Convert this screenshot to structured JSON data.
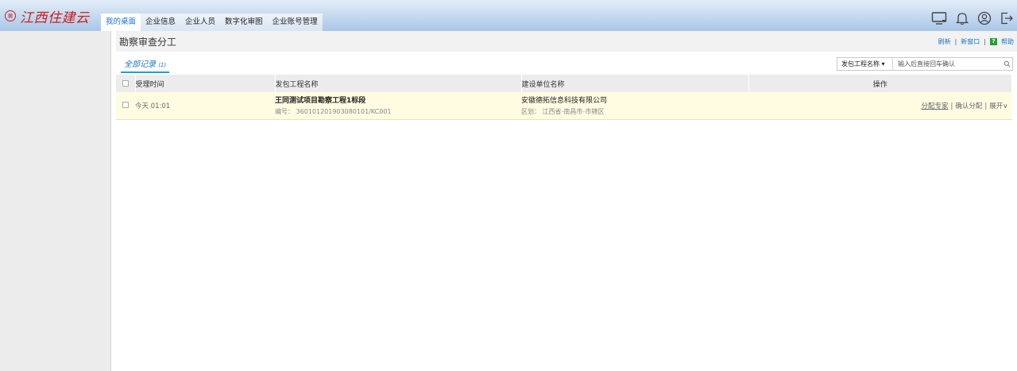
{
  "app": {
    "logo_text": "江西住建云",
    "logo_mark": "⊞"
  },
  "nav": {
    "tabs": [
      {
        "label": "我的桌面",
        "active": true
      },
      {
        "label": "企业信息",
        "active": false
      },
      {
        "label": "企业人员",
        "active": false
      },
      {
        "label": "数字化审图",
        "active": false
      },
      {
        "label": "企业账号管理",
        "active": false
      }
    ]
  },
  "top_icons": [
    "monitor-icon",
    "bell-icon",
    "user-icon",
    "logout-icon"
  ],
  "page": {
    "title": "勘察审查分工",
    "links": {
      "refresh": "刷新",
      "new_window": "新窗口",
      "help": "帮助",
      "separator": "|"
    }
  },
  "filter": {
    "tab_label": "全部记录",
    "tab_count": "(1)",
    "search_field": "发包工程名称",
    "search_placeholder": "输入后直接回车确认"
  },
  "table": {
    "headers": {
      "time": "受理时间",
      "project": "发包工程名称",
      "org": "建设单位名称",
      "ops": "操作"
    },
    "rows": [
      {
        "time": "今天 01:01",
        "project_name": "王同测试项目勘察工程1标段",
        "project_code": "编号： 360101201903080101/KC001",
        "org_name": "安徽德拓信息科技有限公司",
        "region": "区划： 江西省-南昌市-市辖区",
        "op_assign": "分配专家",
        "op_confirm": "确认分配",
        "op_expand": "展开∨"
      }
    ]
  },
  "colors": {
    "accent": "#1f74c5",
    "logo_red": "#c9211e",
    "row_highlight": "#fffce2"
  }
}
